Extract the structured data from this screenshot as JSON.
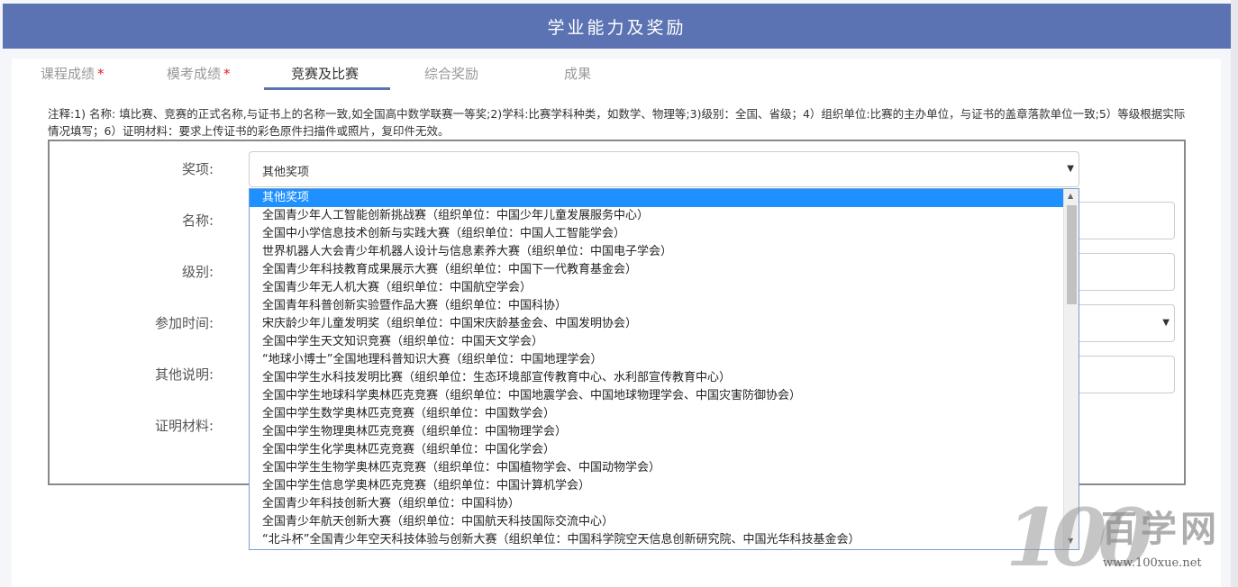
{
  "header": {
    "title": "学业能力及奖励"
  },
  "tabs": [
    {
      "label": "课程成绩",
      "required_mark": "*"
    },
    {
      "label": "模考成绩",
      "required_mark": "*"
    },
    {
      "label": "竞赛及比赛"
    },
    {
      "label": "综合奖励"
    },
    {
      "label": "成果"
    }
  ],
  "note": "注释:1) 名称: 填比赛、竞赛的正式名称,与证书上的名称一致,如全国高中数学联赛一等奖;2)学科:比赛学科种类，如数学、物理等;3)级别：全国、省级；4）组织单位:比赛的主办单位，与证书的盖章落款单位一致;5）等级根据实际情况填写；6）证明材料：要求上传证书的彩色原件扫描件或照片，复印件无效。",
  "form": {
    "labels": {
      "award": "奖项:",
      "name": "名称:",
      "level": "级别:",
      "time": "参加时间:",
      "other": "其他说明:",
      "proof": "证明材料:"
    },
    "award_value": "其他奖项"
  },
  "dropdown": {
    "options": [
      "其他奖项",
      "全国青少年人工智能创新挑战赛（组织单位：中国少年儿童发展服务中心）",
      "全国中小学信息技术创新与实践大赛（组织单位：中国人工智能学会）",
      "世界机器人大会青少年机器人设计与信息素养大赛（组织单位：中国电子学会）",
      "全国青少年科技教育成果展示大赛（组织单位：中国下一代教育基金会）",
      "全国青少年无人机大赛（组织单位：中国航空学会）",
      "全国青年科普创新实验暨作品大赛（组织单位：中国科协）",
      "宋庆龄少年儿童发明奖（组织单位：中国宋庆龄基金会、中国发明协会）",
      "全国中学生天文知识竞赛（组织单位：中国天文学会）",
      "“地球小博士”全国地理科普知识大赛（组织单位：中国地理学会）",
      "全国中学生水科技发明比赛（组织单位：生态环境部宣传教育中心、水利部宣传教育中心）",
      "全国中学生地球科学奥林匹克竞赛（组织单位：中国地震学会、中国地球物理学会、中国灾害防御协会）",
      "全国中学生数学奥林匹克竞赛（组织单位：中国数学会）",
      "全国中学生物理奥林匹克竞赛（组织单位：中国物理学会）",
      "全国中学生化学奥林匹克竞赛（组织单位：中国化学会）",
      "全国中学生生物学奥林匹克竞赛（组织单位：中国植物学会、中国动物学会）",
      "全国中学生信息学奥林匹克竞赛（组织单位：中国计算机学会）",
      "全国青少年科技创新大赛（组织单位：中国科协）",
      "全国青少年航天创新大赛（组织单位：中国航天科技国际交流中心）",
      "“北斗杯”全国青少年空天科技体验与创新大赛（组织单位：中国科学院空天信息创新研究院、中国光华科技基金会）"
    ]
  },
  "watermark": {
    "logo": "100",
    "text": "百学网",
    "url": "www.100xue.net"
  },
  "icons": {
    "caret": "▼",
    "scroll_up": "▲",
    "scroll_down": "▼"
  },
  "colors": {
    "header": "#5b73b2",
    "selected": "#1e90ff",
    "required": "#e02020"
  }
}
